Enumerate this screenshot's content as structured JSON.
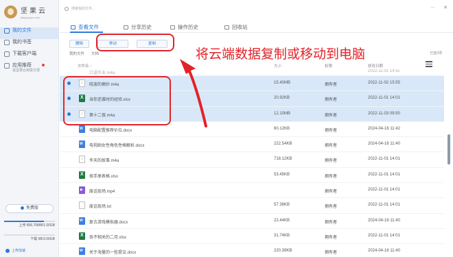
{
  "app": {
    "logo_name": "坚果云",
    "logo_url": "jianguoyun.com",
    "search_placeholder": "搜索我的文件..."
  },
  "sidebar": {
    "items": [
      {
        "label": "我的文件",
        "sub": "",
        "active": true
      },
      {
        "label": "我的书签",
        "sub": "",
        "active": false
      },
      {
        "label": "下载客户端",
        "sub": "",
        "active": false
      },
      {
        "label": "应用推荐",
        "sub": "说坚果云用更方便",
        "active": false
      }
    ],
    "vip_label": "免费版",
    "upload_quota": "上传 806.70MB/1.00GB",
    "download_quota": "下载 0B/3.00GB",
    "upload_fraction": 0.79,
    "download_fraction": 0.0,
    "upload_tip": "上传加速"
  },
  "tabs": [
    {
      "label": "查看文件",
      "icon": "folder-icon",
      "active": true
    },
    {
      "label": "分享历史",
      "icon": "share-icon",
      "active": false
    },
    {
      "label": "操作历史",
      "icon": "history-icon",
      "active": false
    },
    {
      "label": "回收站",
      "icon": "trash-icon",
      "active": false
    }
  ],
  "toolbar": {
    "delete_label": "删除",
    "move_label": "移动",
    "copy_label": "复制"
  },
  "breadcrumb": {
    "root": "我的文件",
    "current": "文档"
  },
  "selection_info": "已选3项",
  "columns": {
    "name": "文件名 ↑",
    "size": "大小",
    "perm": "权限",
    "date": "修改日期"
  },
  "files": [
    {
      "name": "口语作业.m4a",
      "size": "",
      "perm": "",
      "date": "2022-11-01 14:xx",
      "type": "audio",
      "selected": false
    },
    {
      "name": "晓波的摘抄.m4a",
      "size": "15.40MB",
      "perm": "拥有者",
      "date": "2022-11-02 15:55",
      "type": "audio",
      "selected": true
    },
    {
      "name": "当你逆袭时的经验.xlsx",
      "size": "20.92KB",
      "perm": "拥有者",
      "date": "2022-11-01 14:01",
      "type": "excel",
      "selected": true
    },
    {
      "name": "第十二夜.m4a",
      "size": "12.10MB",
      "perm": "拥有者",
      "date": "2022-11-03 09:50",
      "type": "audio",
      "selected": true
    },
    {
      "name": "电脑配置推荐价位.docx",
      "size": "60.12KB",
      "perm": "拥有者",
      "date": "2024-04-16 11:42",
      "type": "word",
      "selected": false
    },
    {
      "name": "电视剧女性角色性格解析.docx",
      "size": "222.54KB",
      "perm": "拥有者",
      "date": "2024-04-16 11:40",
      "type": "word",
      "selected": false
    },
    {
      "name": "冬天的故事.m4a",
      "size": "718.12KB",
      "perm": "拥有者",
      "date": "2022-11-01 14:01",
      "type": "audio",
      "selected": false
    },
    {
      "name": "按手册表格.xlsx",
      "size": "53.45KB",
      "perm": "拥有者",
      "date": "2022-11-01 14:01",
      "type": "excel",
      "selected": false
    },
    {
      "name": "废话现场.mp4",
      "size": "",
      "perm": "拥有者",
      "date": "2022-11-01 14:01",
      "type": "video",
      "selected": false
    },
    {
      "name": "废话现场.txt",
      "size": "57.38KB",
      "perm": "拥有者",
      "date": "2022-11-01 14:01",
      "type": "txt",
      "selected": false
    },
    {
      "name": "复古游戏模拟器.docx",
      "size": "22.44KB",
      "perm": "拥有者",
      "date": "2024-04-16 11:40",
      "type": "word",
      "selected": false
    },
    {
      "name": "各不相关的二月.xlsx",
      "size": "31.74KB",
      "perm": "拥有者",
      "date": "2022-11-01 14:01",
      "type": "excel",
      "selected": false
    },
    {
      "name": "关于海量的一些提议.docx",
      "size": "220.39KB",
      "perm": "拥有者",
      "date": "2024-04-16 11:40",
      "type": "word",
      "selected": false
    }
  ],
  "annotation": "将云端数据复制或移动到电脑",
  "colors": {
    "accent": "#2f79d6",
    "highlight": "#e2232a",
    "selected_row": "#d9e8f8"
  }
}
